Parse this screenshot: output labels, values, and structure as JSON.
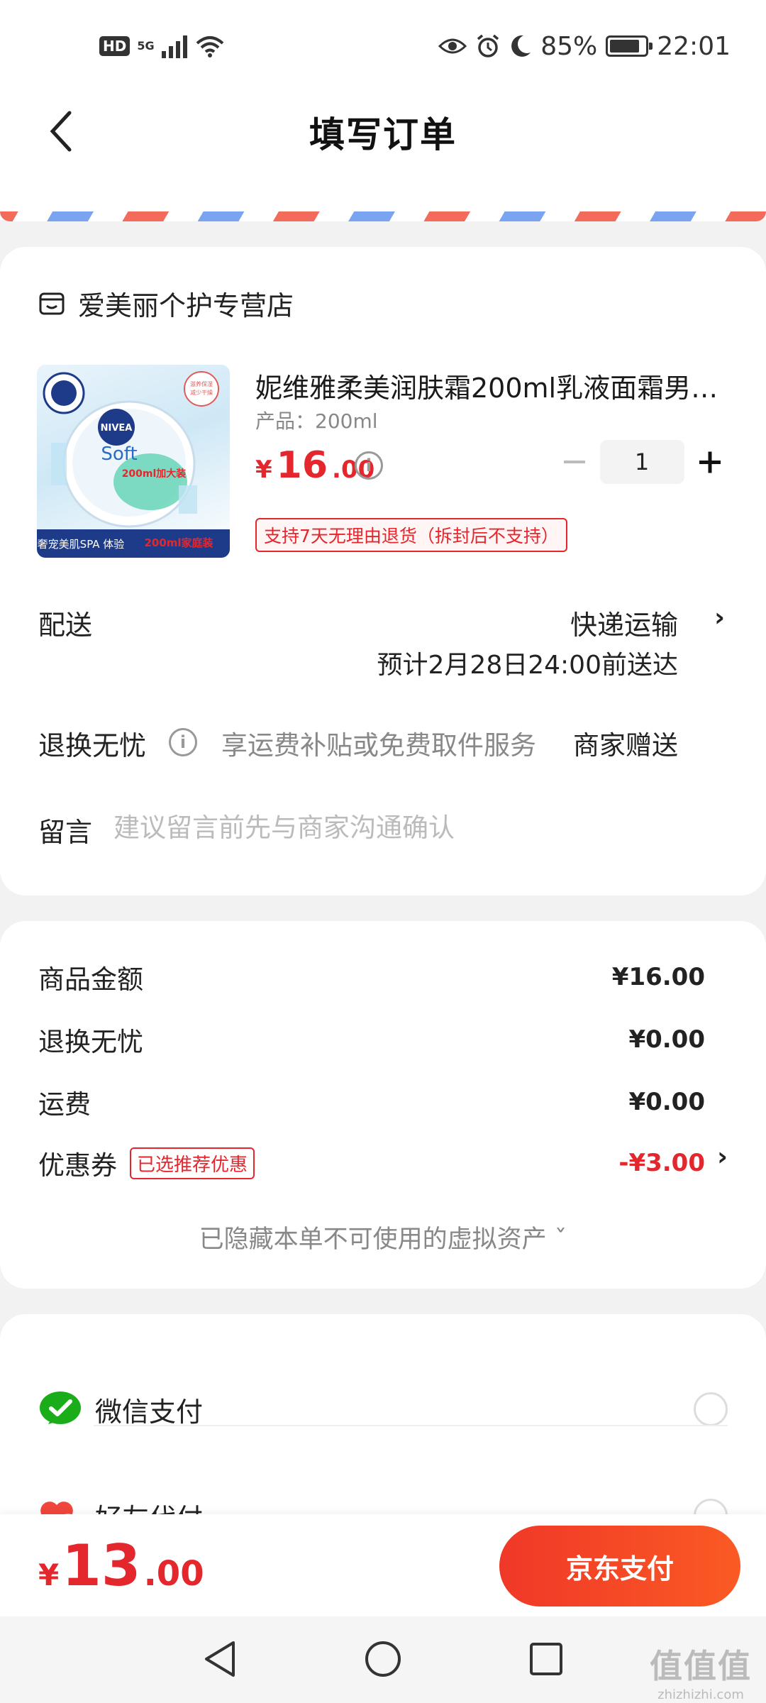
{
  "status_bar": {
    "hd_badge": "HD",
    "network": "5G",
    "battery_percent": "85%",
    "battery_level": 0.85,
    "time": "22:01",
    "icons": [
      "eye-icon",
      "alarm-icon",
      "moon-icon"
    ]
  },
  "nav": {
    "title": "填写订单",
    "back_icon": "chevron-left-icon"
  },
  "store": {
    "name": "爱美丽个护专营店",
    "icon": "store-icon"
  },
  "product": {
    "title": "妮维雅柔美润肤霜200ml乳液面霜男…",
    "spec": "产品：200ml",
    "price_symbol": "¥",
    "price_int": "16",
    "price_dec": ".00",
    "quantity": "1",
    "return_policy": "支持7天无理由退货（拆封后不支持）",
    "image": {
      "brand": "NIVEA",
      "line": "Soft",
      "size_label": "200ml加大装",
      "banner_left": "奢宠美肌SPA 体验",
      "banner_right": "200ml家庭装",
      "stamp": "滋养保湿 减少干燥"
    }
  },
  "delivery": {
    "label": "配送",
    "method": "快递运输",
    "eta": "预计2月28日24:00前送达"
  },
  "worry_free": {
    "label": "退换无忧",
    "desc": "享运费补贴或免费取件服务",
    "gift": "商家赠送"
  },
  "message": {
    "label": "留言",
    "placeholder": "建议留言前先与商家沟通确认"
  },
  "summary": {
    "goods_label": "商品金额",
    "goods_value": "¥16.00",
    "worry_label": "退换无忧",
    "worry_value": "¥0.00",
    "freight_label": "运费",
    "freight_value": "¥0.00",
    "coupon_label": "优惠券",
    "coupon_tag": "已选推荐优惠",
    "coupon_value": "-¥3.00",
    "hidden_assets": "已隐藏本单不可使用的虚拟资产 ˇ"
  },
  "payment": {
    "wechat_label": "微信支付",
    "friend_label": "好友代付"
  },
  "bottom": {
    "total_symbol": "¥",
    "total_int": "13",
    "total_dec": ".00",
    "pay_button": "京东支付"
  },
  "watermark": {
    "big": "值值值",
    "small": "zhizhizhi.com"
  },
  "colors": {
    "accent_red": "#e4262d",
    "wechat_green": "#1aad19",
    "pay_button_start": "#f03828",
    "pay_button_end": "#fa5a24"
  }
}
